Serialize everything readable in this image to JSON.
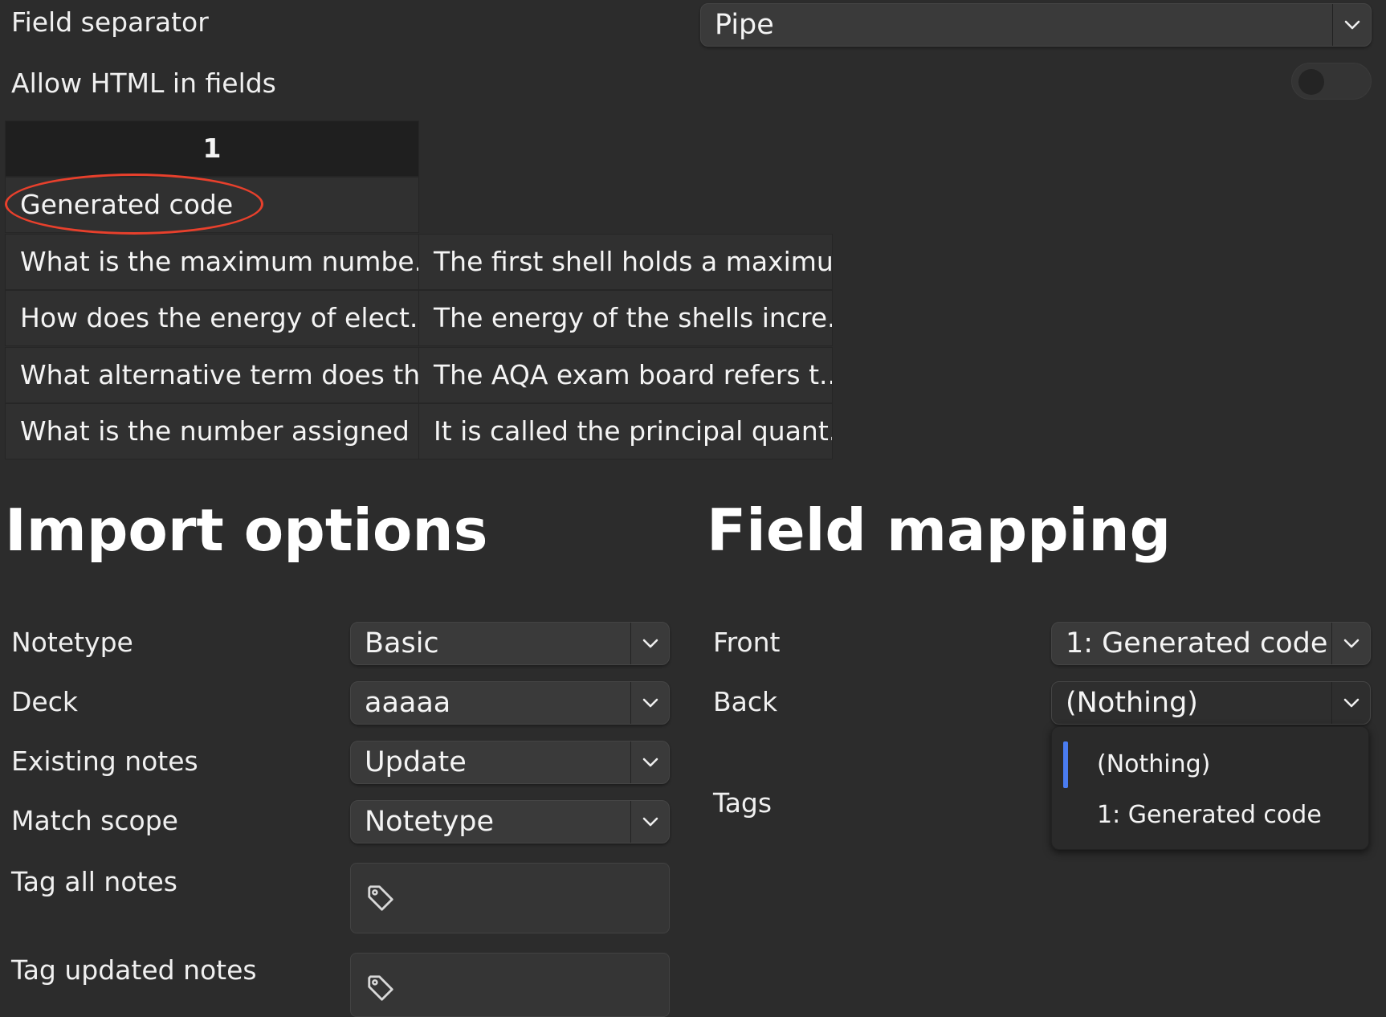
{
  "top": {
    "field_separator_label": "Field separator",
    "field_separator_value": "Pipe",
    "allow_html_label": "Allow HTML in fields",
    "allow_html_on": false
  },
  "preview": {
    "header": "1",
    "first_row": "Generated code",
    "rows": [
      [
        "What is the maximum numbe...",
        "The first shell holds a maximu..."
      ],
      [
        "How does the energy of elect...",
        "The energy of the shells incre..."
      ],
      [
        "What alternative term does th...",
        "The AQA exam board refers t..."
      ],
      [
        "What is the number assigned ...",
        "It is called the principal quant..."
      ]
    ]
  },
  "import_options": {
    "heading": "Import options",
    "notetype_label": "Notetype",
    "notetype_value": "Basic",
    "deck_label": "Deck",
    "deck_value": "aaaaa",
    "existing_notes_label": "Existing notes",
    "existing_notes_value": "Update",
    "match_scope_label": "Match scope",
    "match_scope_value": "Notetype",
    "tag_all_label": "Tag all notes",
    "tag_updated_label": "Tag updated notes"
  },
  "field_mapping": {
    "heading": "Field mapping",
    "front_label": "Front",
    "front_value": "1: Generated code",
    "back_label": "Back",
    "back_value": "(Nothing)",
    "tags_label": "Tags",
    "dropdown_options": [
      "(Nothing)",
      "1: Generated code"
    ],
    "dropdown_selected": "(Nothing)"
  },
  "colors": {
    "background": "#2c2c2c",
    "accent": "#4a7cf0",
    "annotation": "#e8402c"
  },
  "icons": [
    "chevron-down-icon",
    "tag-icon"
  ]
}
